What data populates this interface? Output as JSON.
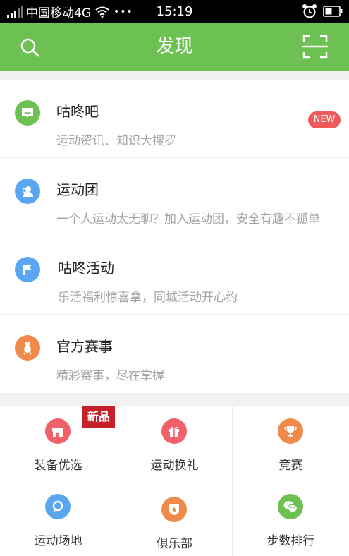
{
  "status_bar": {
    "carrier": "中国移动4G",
    "more": "•••",
    "time": "15:19"
  },
  "nav": {
    "title": "发现"
  },
  "list": [
    {
      "title": "咕咚吧",
      "subtitle": "运动资讯、知识大搜罗",
      "badge": "NEW",
      "icon": "chat-bubble-icon",
      "color": "#6cc152"
    },
    {
      "title": "运动团",
      "subtitle": "一个人运动太无聊？加入运动团，安全有趣不孤单",
      "icon": "group-icon",
      "color": "#5aa6f0"
    },
    {
      "title": "咕咚活动",
      "subtitle": "乐活福利惊喜拿，同城活动开心约",
      "icon": "flag-icon",
      "color": "#5aa6f0"
    },
    {
      "title": "官方赛事",
      "subtitle": "精彩赛事，尽在掌握",
      "icon": "medal-icon",
      "color": "#f08a4b"
    }
  ],
  "grid": [
    {
      "label": "装备优选",
      "icon": "store-icon",
      "color": "#f0616a",
      "tag": "新品"
    },
    {
      "label": "运动换礼",
      "icon": "gift-icon",
      "color": "#f0616a"
    },
    {
      "label": "竞赛",
      "icon": "trophy-icon",
      "color": "#f08a4b"
    },
    {
      "label": "运动场地",
      "icon": "location-icon",
      "color": "#5aa6f0"
    },
    {
      "label": "俱乐部",
      "icon": "star-shield-icon",
      "color": "#f08a4b"
    },
    {
      "label": "步数排行",
      "icon": "wechat-icon",
      "color": "#6cc152"
    }
  ]
}
